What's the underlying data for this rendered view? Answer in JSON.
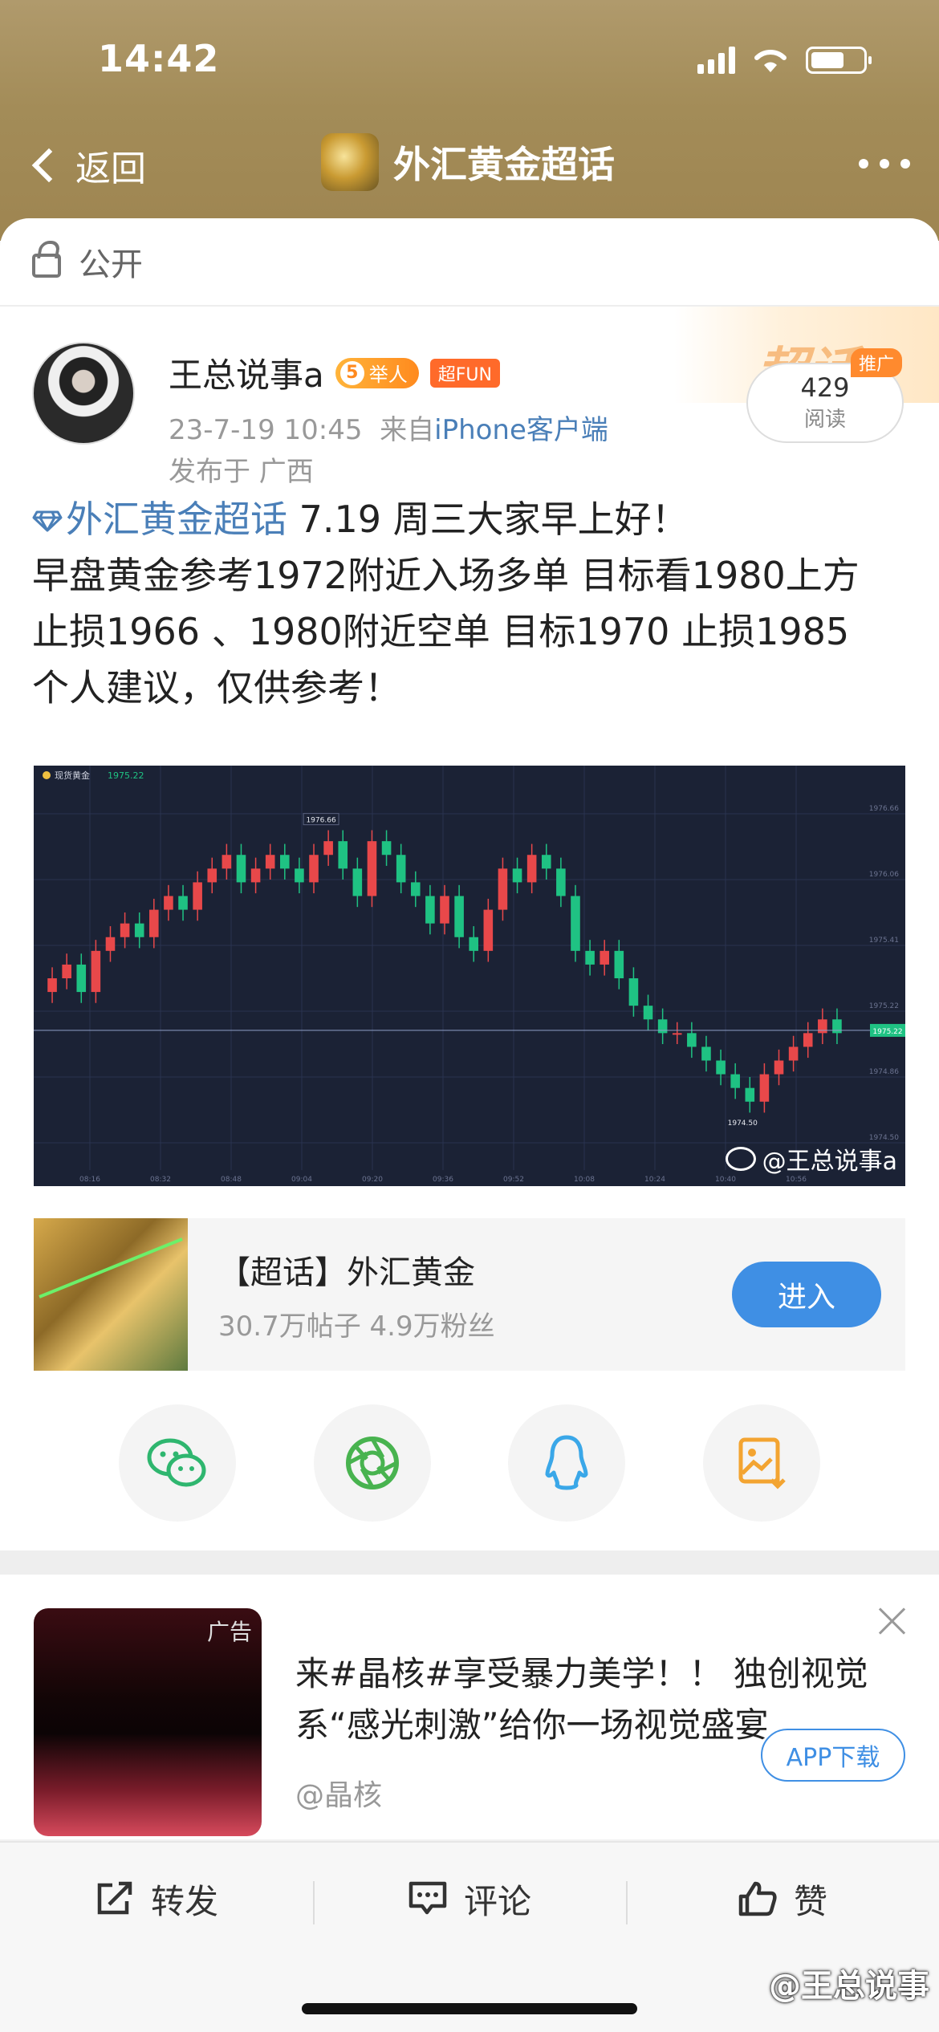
{
  "status": {
    "time": "14:42"
  },
  "nav": {
    "back_label": "返回",
    "title": "外汇黄金超话"
  },
  "visibility": {
    "label": "公开"
  },
  "author": {
    "name": "王总说事a",
    "level": "5",
    "level_label": "举人",
    "fun_badge": "超FUN",
    "date": "23-7-19 10:45",
    "from_prefix": "来自",
    "source": "iPhone客户端",
    "location": "发布于 广西"
  },
  "read": {
    "count": "429",
    "label": "阅读",
    "promo": "推广",
    "deco": "超话"
  },
  "post": {
    "topic": "外汇黄金超话",
    "line1_rest": " 7.19 周三大家早上好！",
    "line2": "早盘黄金参考1972附近入场多单 目标看1980上方",
    "line3": "止损1966 、1980附近空单 目标1970 止损1985",
    "line4": "个人建议，仅供参考！"
  },
  "image_watermark": "@王总说事a",
  "chart_data": {
    "type": "candlestick",
    "title": "现货黄金",
    "last_price": "1975.22",
    "high_label": "1976.66",
    "low_label": "1974.50",
    "current_label": "1975.22",
    "x_ticks": [
      "08:16",
      "08:32",
      "08:48",
      "09:04",
      "09:20",
      "09:36",
      "09:52",
      "10:08",
      "10:24",
      "10:40",
      "10:56"
    ],
    "y_ticks": [
      "1976.66",
      "1976.06",
      "1975.41",
      "1975.22",
      "1974.86",
      "1974.50"
    ],
    "closes": [
      1975.6,
      1975.7,
      1975.5,
      1975.8,
      1975.9,
      1976.0,
      1975.9,
      1976.1,
      1976.2,
      1976.1,
      1976.3,
      1976.4,
      1976.5,
      1976.3,
      1976.4,
      1976.5,
      1976.4,
      1976.3,
      1976.5,
      1976.6,
      1976.4,
      1976.2,
      1976.6,
      1976.5,
      1976.3,
      1976.2,
      1976.0,
      1976.2,
      1975.9,
      1975.8,
      1976.1,
      1976.4,
      1976.3,
      1976.5,
      1976.4,
      1976.2,
      1975.8,
      1975.7,
      1975.8,
      1975.6,
      1975.4,
      1975.3,
      1975.2,
      1975.2,
      1975.1,
      1975.0,
      1974.9,
      1974.8,
      1974.7,
      1974.9,
      1975.0,
      1975.1,
      1975.2,
      1975.3,
      1975.2
    ]
  },
  "topic_card": {
    "title": "【超话】外汇黄金",
    "stats": "30.7万帖子 4.9万粉丝",
    "enter_label": "进入"
  },
  "ad": {
    "tag": "广告",
    "text": "来#晶核#享受暴力美学！！ 独创视觉系“感光刺激”给你一场视觉盛宴",
    "source": "@晶核",
    "download_label": "APP下载"
  },
  "actions": {
    "repost": "转发",
    "comment": "评论",
    "like": "赞"
  },
  "corner_watermark": "@王总说事",
  "colors": {
    "accent": "#3f8fe4",
    "up": "#e8484a",
    "down": "#1fc283",
    "header": "#a38c58"
  }
}
